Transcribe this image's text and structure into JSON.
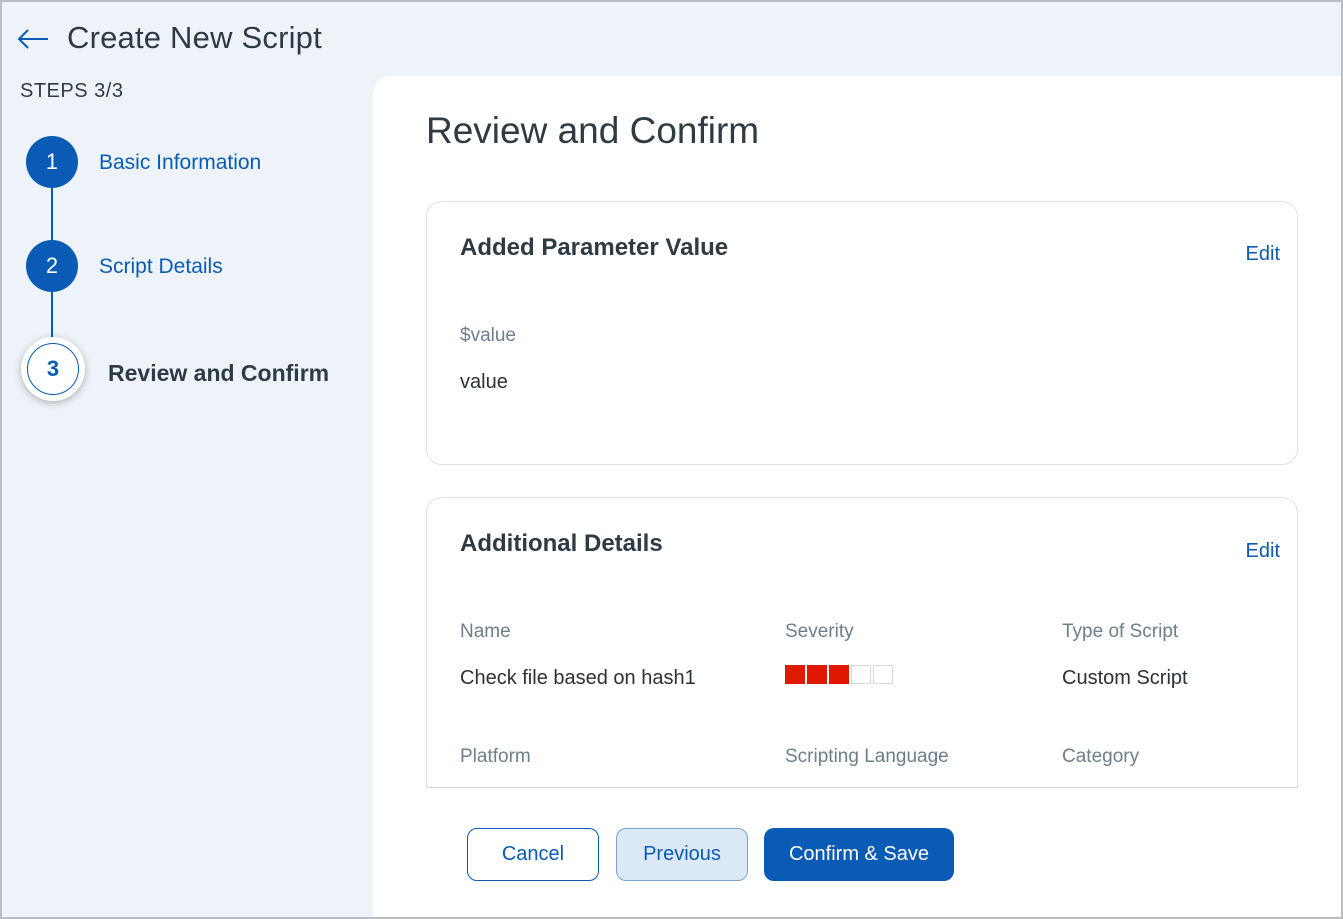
{
  "header": {
    "title": "Create New Script"
  },
  "stepper": {
    "steps_label": "STEPS 3/3",
    "steps": [
      {
        "number": "1",
        "label": "Basic Information"
      },
      {
        "number": "2",
        "label": "Script Details"
      },
      {
        "number": "3",
        "label": "Review and Confirm"
      }
    ]
  },
  "main": {
    "title": "Review and Confirm",
    "parameter_card": {
      "title": "Added Parameter Value",
      "edit_label": "Edit",
      "param_name": "$value",
      "param_value": "value"
    },
    "details_card": {
      "title": "Additional Details",
      "edit_label": "Edit",
      "fields": {
        "name_label": "Name",
        "name_value": "Check file based on hash1",
        "severity_label": "Severity",
        "severity_level": 3,
        "severity_max": 5,
        "type_label": "Type of Script",
        "type_value": "Custom Script",
        "platform_label": "Platform",
        "language_label": "Scripting Language",
        "category_label": "Category"
      }
    }
  },
  "actions": {
    "cancel_label": "Cancel",
    "previous_label": "Previous",
    "confirm_label": "Confirm & Save"
  },
  "colors": {
    "accent": "#0a5bb5",
    "severity": "#e01a00",
    "background": "#eef3fa"
  }
}
